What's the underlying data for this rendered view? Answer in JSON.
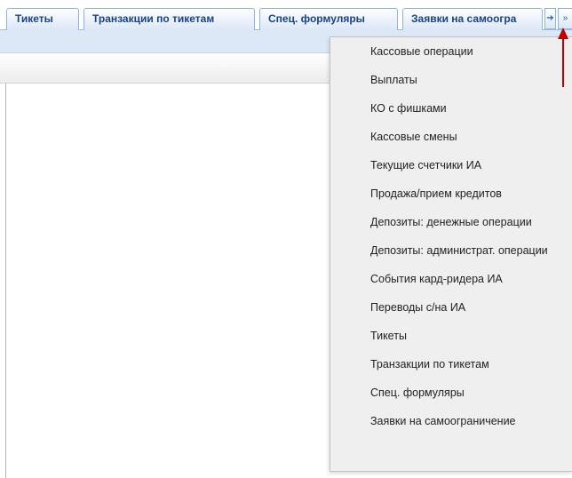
{
  "tabs": [
    {
      "label": "Тикеты"
    },
    {
      "label": "Транзакции по тикетам"
    },
    {
      "label": "Спец. формуляры"
    },
    {
      "label": "Заявки на самоогра"
    }
  ],
  "tab_scroll_glyphs": {
    "right": "➔",
    "menu": "»"
  },
  "menu": {
    "items": [
      "Кассовые операции",
      "Выплаты",
      "КО с фишками",
      "Кассовые смены",
      "Текущие счетчики ИА",
      "Продажа/прием кредитов",
      "Депозиты: денежные операции",
      "Депозиты: администрат. операции",
      "События кард-ридера ИА",
      "Переводы с/на ИА",
      "Тикеты",
      "Транзакции по тикетам",
      "Спец. формуляры",
      "Заявки на самоограничение"
    ]
  },
  "colors": {
    "tab_text": "#15428b",
    "annotation_arrow": "#c00000"
  }
}
